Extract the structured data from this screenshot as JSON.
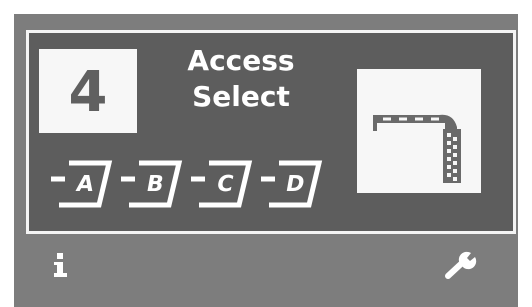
{
  "display": {
    "count_value": "4",
    "title_line1": "Access",
    "title_line2": "Select"
  },
  "options": [
    {
      "label": "A"
    },
    {
      "label": "B"
    },
    {
      "label": "C"
    },
    {
      "label": "D"
    }
  ],
  "icons": {
    "barrier": "barrier-gate-icon",
    "info": "info-icon",
    "settings": "wrench-icon"
  },
  "colors": {
    "panel_background": "#5d5d5d",
    "device_background": "#7d7d7d",
    "foreground": "#ffffff"
  }
}
